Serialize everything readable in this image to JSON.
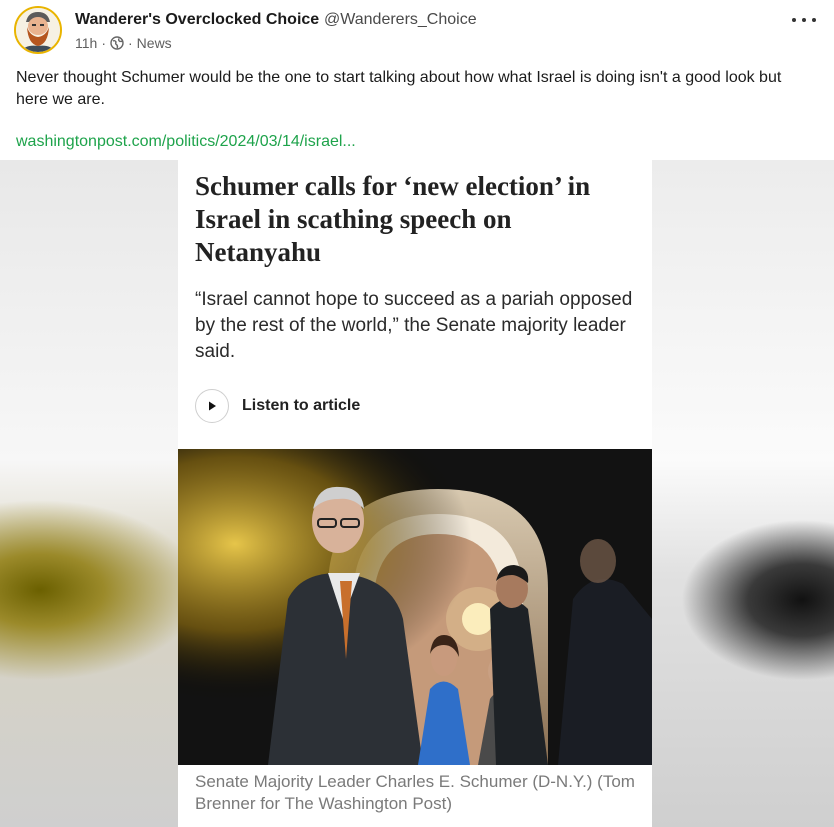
{
  "post": {
    "display_name": "Wanderer's Overclocked Choice",
    "handle": "@Wanderers_Choice",
    "time": "11h",
    "separator": "·",
    "category": "News",
    "text": "Never thought Schumer would be the one to start talking about how what Israel is doing isn't a good look but here we are.",
    "link_text": "washingtonpost.com/politics/2024/03/14/israel..."
  },
  "article": {
    "headline": "Schumer calls for ‘new election’ in Israel in scathing speech on Netanyahu",
    "subhead": "“Israel cannot hope to succeed as a pariah opposed by the rest of the world,” the Senate majority leader said.",
    "listen_label": "Listen to article",
    "caption": "Senate Majority Leader Charles E. Schumer (D-N.Y.) (Tom Brenner for The Washington Post)"
  },
  "icons": {
    "avatar": "bearded-man-avatar",
    "visibility": "globe-icon",
    "menu": "more-options-icon",
    "play": "play-icon"
  },
  "colors": {
    "link": "#1ea34b",
    "avatar_ring": "#e9b400"
  }
}
